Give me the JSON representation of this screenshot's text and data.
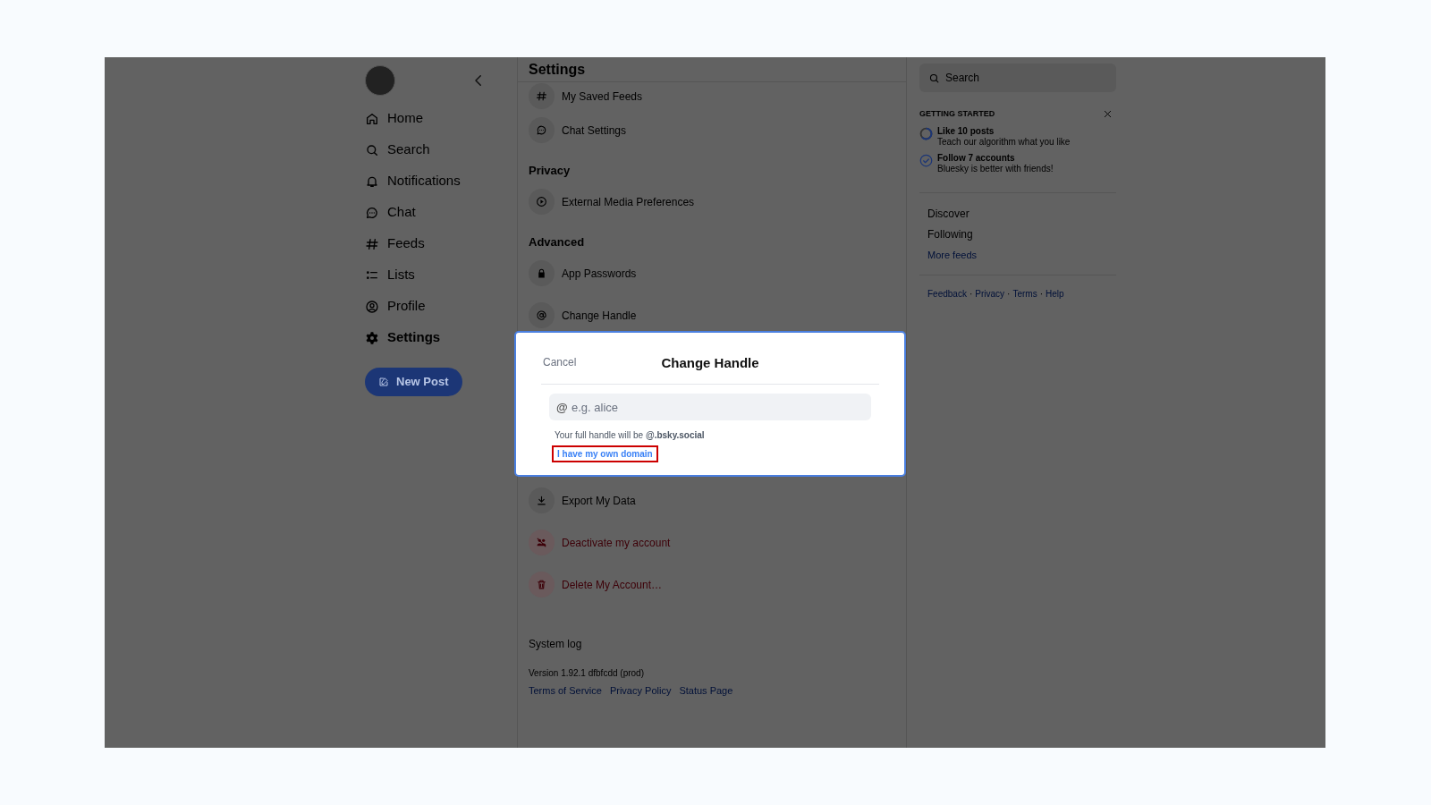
{
  "sidebar": {
    "nav": [
      {
        "label": "Home",
        "selected": false
      },
      {
        "label": "Search",
        "selected": false
      },
      {
        "label": "Notifications",
        "selected": false
      },
      {
        "label": "Chat",
        "selected": false
      },
      {
        "label": "Feeds",
        "selected": false
      },
      {
        "label": "Lists",
        "selected": false
      },
      {
        "label": "Profile",
        "selected": false
      },
      {
        "label": "Settings",
        "selected": true
      }
    ],
    "new_post": "New Post"
  },
  "settings": {
    "title": "Settings",
    "rows": [
      {
        "kind": "item",
        "label": "My Saved Feeds",
        "danger": false
      },
      {
        "kind": "item",
        "label": "Chat Settings",
        "danger": false
      },
      {
        "kind": "heading",
        "label": "Privacy"
      },
      {
        "kind": "item",
        "label": "External Media Preferences",
        "danger": false
      },
      {
        "kind": "heading",
        "label": "Advanced"
      },
      {
        "kind": "item",
        "label": "App Passwords",
        "danger": false
      },
      {
        "kind": "item",
        "label": "Change Handle",
        "danger": false
      },
      {
        "kind": "covered"
      },
      {
        "kind": "item",
        "label": "Export My Data",
        "danger": false
      },
      {
        "kind": "item",
        "label": "Deactivate my account",
        "danger": true
      },
      {
        "kind": "item",
        "label": "Delete My Account…",
        "danger": true
      }
    ],
    "system_log": "System log",
    "version": "Version 1.92.1 dfbfcdd (prod)",
    "links": [
      "Terms of Service",
      "Privacy Policy",
      "Status Page"
    ]
  },
  "right": {
    "search": {
      "placeholder": "Search"
    },
    "getting_started": {
      "title": "GETTING STARTED",
      "tasks": [
        {
          "title": "Like 10 posts",
          "subtitle": "Teach our algorithm what you like",
          "complete": false
        },
        {
          "title": "Follow 7 accounts",
          "subtitle": "Bluesky is better with friends!",
          "complete": true
        }
      ]
    },
    "feeds": [
      "Discover",
      "Following"
    ],
    "more_feeds": "More feeds",
    "footer_links": [
      "Feedback",
      "Privacy",
      "Terms",
      "Help"
    ],
    "separator": "·"
  },
  "modal": {
    "cancel": "Cancel",
    "title": "Change Handle",
    "prefix": "@",
    "placeholder": "e.g. alice",
    "hint": "Your full handle will be **@.bsky.social**",
    "link": "I have my own domain",
    "link_highlighted": true
  }
}
